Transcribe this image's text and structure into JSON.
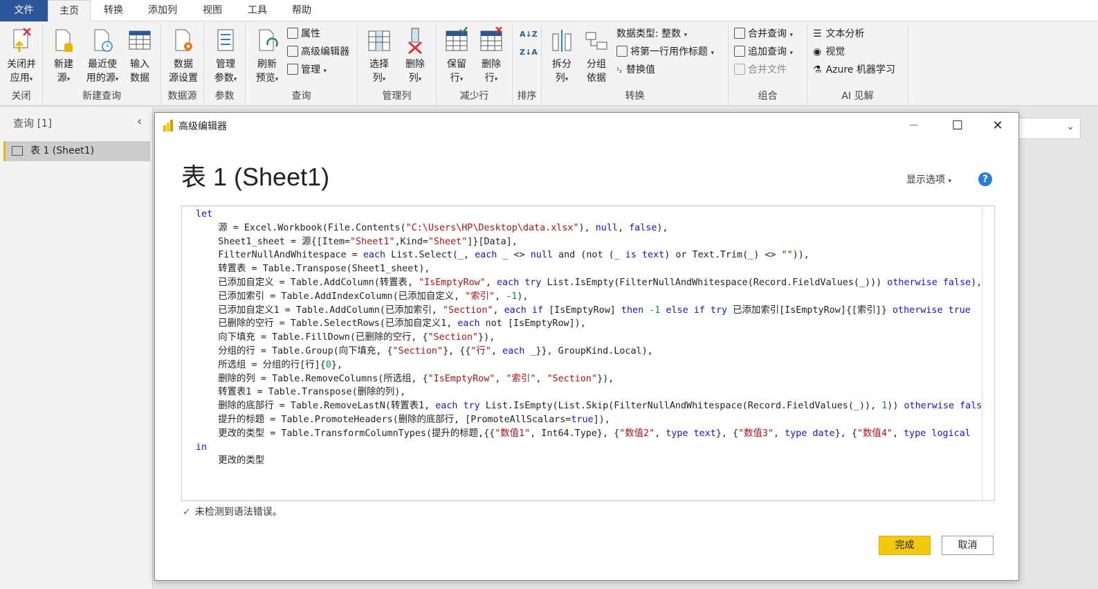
{
  "tabs": [
    "文件",
    "主页",
    "转换",
    "添加列",
    "视图",
    "工具",
    "帮助"
  ],
  "ribbon": {
    "close_apply": "关闭并\n应用",
    "new_source": "新建\n源",
    "recent_sources": "最近使\n用的源",
    "enter_data": "输入\n数据",
    "data_source_settings": "数据\n源设置",
    "manage_params": "管理\n参数",
    "refresh_preview": "刷新\n预览",
    "properties": "属性",
    "advanced_editor": "高级编辑器",
    "manage": "管理",
    "choose_columns": "选择\n列",
    "remove_columns": "删除\n列",
    "keep_rows": "保留\n行",
    "remove_rows": "删除\n行",
    "split_column": "拆分\n列",
    "group_by": "分组\n依据",
    "data_type": "数据类型: 整数",
    "first_row_header": "将第一行用作标题",
    "replace_values": "替换值",
    "merge_queries": "合并查询",
    "append_queries": "追加查询",
    "combine_files": "合并文件",
    "text_analytics": "文本分析",
    "vision": "视觉",
    "azure_ml": "Azure 机器学习",
    "groups": {
      "close": "关闭",
      "new_query": "新建查询",
      "data_sources": "数据源",
      "params": "参数",
      "query": "查询",
      "manage_cols": "管理列",
      "reduce_rows": "减少行",
      "sort": "排序",
      "transform": "转换",
      "combine": "组合",
      "ai": "AI 见解"
    }
  },
  "left_pane": {
    "title": "查询 [1]",
    "item": "表 1 (Sheet1)"
  },
  "dialog": {
    "window_title": "高级编辑器",
    "heading": "表 1 (Sheet1)",
    "display_options": "显示选项",
    "status": "未检测到语法错误。",
    "done": "完成",
    "cancel": "取消"
  }
}
